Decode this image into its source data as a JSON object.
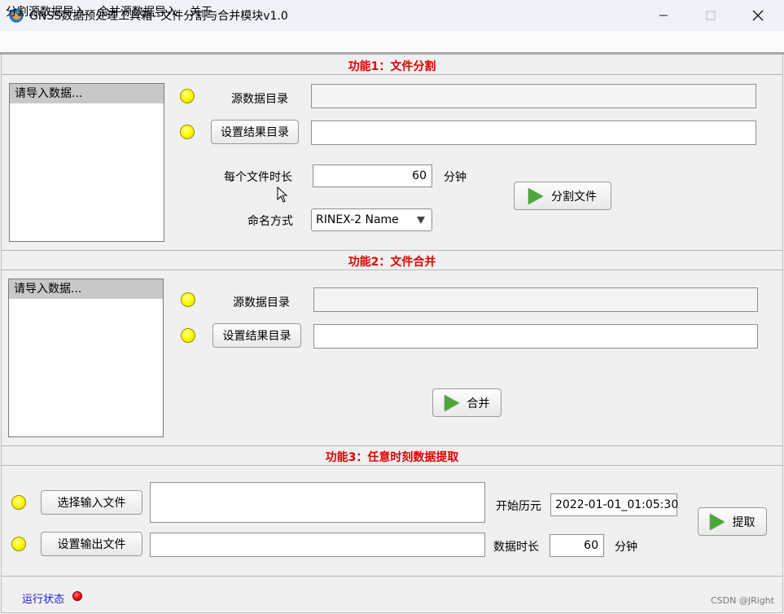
{
  "window": {
    "title": "GNSS数据预处理工具箱--文件分割与合并模块v1.0",
    "app_icon": "app-icon",
    "min_icon": "minimize-icon",
    "max_icon": "maximize-icon",
    "close_icon": "close-icon"
  },
  "menu": {
    "items": [
      "分割源数据导入",
      "合并源数据导入",
      "关于"
    ]
  },
  "split": {
    "title": "功能1：文件分割",
    "list_item": "请导入数据...",
    "source_label": "源数据目录",
    "source_value": "",
    "result_button": "设置结果目录",
    "result_value": "",
    "duration_label": "每个文件时长",
    "duration_value": "60",
    "duration_unit": "分钟",
    "naming_label": "命名方式",
    "naming_value": "RINEX-2 Name",
    "split_button": "分割文件"
  },
  "merge": {
    "title": "功能2：文件合并",
    "list_item": "请导入数据...",
    "source_label": "源数据目录",
    "source_value": "",
    "result_button": "设置结果目录",
    "result_value": "",
    "merge_button": "合并"
  },
  "extract": {
    "title": "功能3：任意时刻数据提取",
    "input_button": "选择输入文件",
    "input_value": "",
    "output_button": "设置输出文件",
    "output_value": "",
    "start_label": "开始历元",
    "start_value": "2022-01-01_01:05:30",
    "duration_label": "数据时长",
    "duration_value": "60",
    "duration_unit": "分钟",
    "extract_button": "提取"
  },
  "status": {
    "label": "运行状态",
    "lamp_color": "#ff0000"
  },
  "watermark": "CSDN @JRight",
  "colors": {
    "section_title": "#e00000",
    "lamp": "#ffff00",
    "play": "#4aa83a",
    "status_text": "#1a1ad0"
  }
}
